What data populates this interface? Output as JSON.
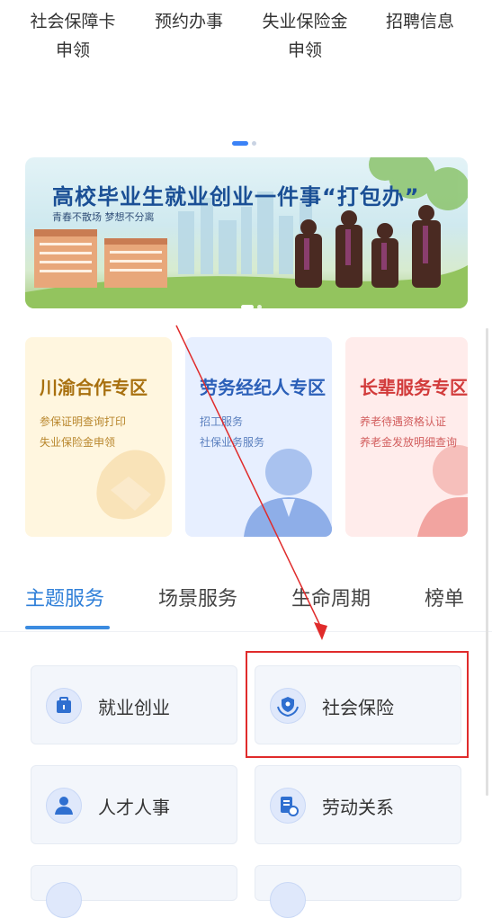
{
  "quick_menu": {
    "items": [
      {
        "line1": "社会保障卡",
        "line2": "申领"
      },
      {
        "line1": "预约办事",
        "line2": ""
      },
      {
        "line1": "失业保险金",
        "line2": "申领"
      },
      {
        "line1": "招聘信息",
        "line2": ""
      }
    ]
  },
  "banner": {
    "title": "高校毕业生就业创业一件事“打包办”",
    "subtitle": "青春不散场  梦想不分离"
  },
  "zones": [
    {
      "title": "川渝合作专区",
      "line1": "参保证明查询打印",
      "line2": "失业保险金申领",
      "title_color": "#a8700f",
      "text_color": "#b8862c",
      "bg": "#fff6df"
    },
    {
      "title": "劳务经纪人专区",
      "line1": "招工服务",
      "line2": "社保业务服务",
      "title_color": "#2b5fb8",
      "text_color": "#5a7fbe",
      "bg": "#e7efff"
    },
    {
      "title": "长辈服务专区",
      "line1": "养老待遇资格认证",
      "line2": "养老金发放明细查询",
      "title_color": "#d23b3b",
      "text_color": "#d25e5e",
      "bg": "#ffeceb"
    }
  ],
  "tabs": {
    "items": [
      "主题服务",
      "场景服务",
      "生命周期",
      "榜单"
    ],
    "active": 0
  },
  "services": [
    {
      "label": "就业创业",
      "icon": "briefcase-icon"
    },
    {
      "label": "社会保险",
      "icon": "hands-shield-icon"
    },
    {
      "label": "人才人事",
      "icon": "person-icon"
    },
    {
      "label": "劳动关系",
      "icon": "document-gear-icon"
    }
  ],
  "colors": {
    "accent": "#2f7fd8",
    "highlight_box": "#e02b2b",
    "annotation_arrow": "#e02b2b"
  }
}
